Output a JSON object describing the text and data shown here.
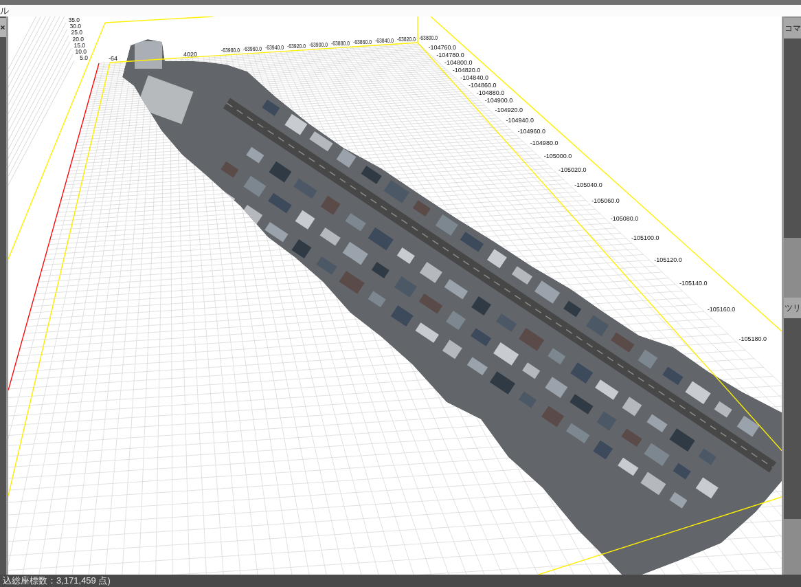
{
  "left_panel": {
    "title": "ル"
  },
  "viewport": {
    "height_labels": [
      "35.0",
      "30.0",
      "25.0",
      "20.0",
      "15.0",
      "10.0",
      "5.0"
    ],
    "top_axis_partial_labels": [
      "-64",
      "4020"
    ],
    "top_axis_labels": [
      "-63980.0",
      "-63960.0",
      "-63940.0",
      "-63920.0",
      "-63900.0",
      "-63880.0",
      "-63860.0",
      "-63840.0",
      "-63820.0",
      "-63800.0"
    ],
    "right_axis_labels": [
      "-104760.0",
      "-104780.0",
      "-104800.0",
      "-104820.0",
      "-104840.0",
      "-104860.0",
      "-104880.0",
      "-104900.0",
      "-104920.0",
      "-104940.0",
      "-104960.0",
      "-104980.0",
      "-105000.0",
      "-105020.0",
      "-105040.0",
      "-105060.0",
      "-105080.0",
      "-105100.0",
      "-105120.0",
      "-105140.0",
      "-105160.0",
      "-105180.0"
    ]
  },
  "right_panel": {
    "tabs": [
      {
        "label": "コマ"
      },
      {
        "label": "ツリ"
      }
    ]
  },
  "status_bar": {
    "text": "込総座標数：3,171,459 点)"
  }
}
